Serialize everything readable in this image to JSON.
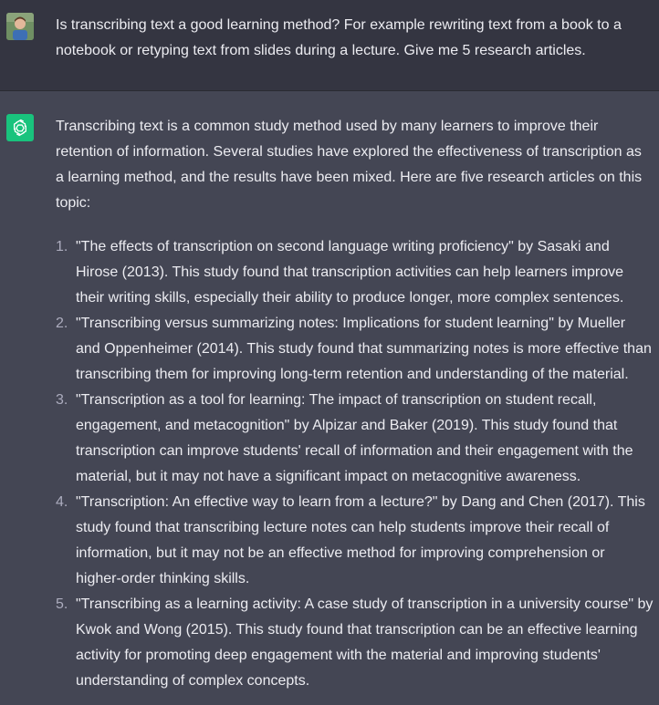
{
  "user": {
    "avatar_icon": "user-photo-avatar",
    "message": "Is transcribing text a good learning method? For example rewriting text from a book to a notebook or retyping text from slides during a lecture. Give me 5 research articles."
  },
  "assistant": {
    "avatar_icon": "openai-logo",
    "avatar_color": "#19c37d",
    "intro": "Transcribing text is a common study method used by many learners to improve their retention of information. Several studies have explored the effectiveness of transcription as a learning method, and the results have been mixed. Here are five research articles on this topic:",
    "articles": [
      {
        "number": "1.",
        "text": "\"The effects of transcription on second language writing proficiency\" by Sasaki and Hirose (2013). This study found that transcription activities can help learners improve their writing skills, especially their ability to produce longer, more complex sentences."
      },
      {
        "number": "2.",
        "text": "\"Transcribing versus summarizing notes: Implications for student learning\" by Mueller and Oppenheimer (2014). This study found that summarizing notes is more effective than transcribing them for improving long-term retention and understanding of the material."
      },
      {
        "number": "3.",
        "text": "\"Transcription as a tool for learning: The impact of transcription on student recall, engagement, and metacognition\" by Alpizar and Baker (2019). This study found that transcription can improve students' recall of information and their engagement with the material, but it may not have a significant impact on metacognitive awareness."
      },
      {
        "number": "4.",
        "text": "\"Transcription: An effective way to learn from a lecture?\" by Dang and Chen (2017). This study found that transcribing lecture notes can help students improve their recall of information, but it may not be an effective method for improving comprehension or higher-order thinking skills."
      },
      {
        "number": "5.",
        "text": "\"Transcribing as a learning activity: A case study of transcription in a university course\" by Kwok and Wong (2015). This study found that transcription can be an effective learning activity for promoting deep engagement with the material and improving students' understanding of complex concepts."
      }
    ]
  },
  "colors": {
    "user_bg": "#343541",
    "assistant_bg": "#444654",
    "text": "#ececf1"
  }
}
